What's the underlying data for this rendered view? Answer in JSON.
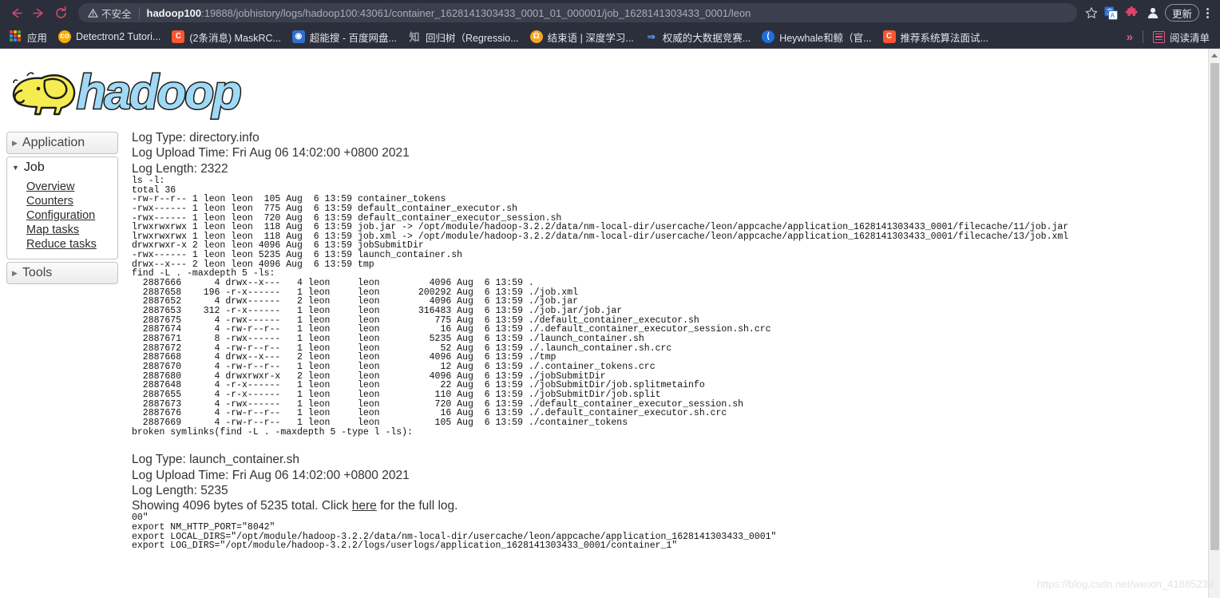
{
  "browser": {
    "nav": {
      "back": "back-arrow",
      "forward": "forward-arrow",
      "reload": "reload"
    },
    "security_label": "不安全",
    "url_host": "hadoop100",
    "url_rest": ":19888/jobhistory/logs/hadoop100:43061/container_1628141303433_0001_01_000001/job_1628141303433_0001/leon",
    "update_label": "更新",
    "bookmarks": [
      {
        "label": "应用",
        "icon": "apps-grid-icon",
        "color": "#4285f4"
      },
      {
        "label": "Detectron2 Tutori...",
        "icon": "colab-icon",
        "color": "#f9ab00"
      },
      {
        "label": "(2条消息) MaskRC...",
        "icon": "csdn-icon",
        "color": "#fc5531"
      },
      {
        "label": "超能搜 - 百度网盘...",
        "icon": "search-blue-icon",
        "color": "#2f6fd0"
      },
      {
        "label": "回归树（Regressio...",
        "icon": "zhihu-icon",
        "color": "#2b2f3b"
      },
      {
        "label": "结束语 | 深度学习...",
        "icon": "geekbang-icon",
        "color": "#f5a623"
      },
      {
        "label": "权威的大数据竞赛...",
        "icon": "ddc-icon",
        "color": "#3a7bd5"
      },
      {
        "label": "Heywhale和鲸（官...",
        "icon": "heywhale-icon",
        "color": "#1e6fd9"
      },
      {
        "label": "推荐系统算法面试...",
        "icon": "csdn-icon",
        "color": "#fc5531"
      }
    ],
    "overflow_label": "»",
    "reading_list_label": "阅读清单"
  },
  "brand": {
    "logo_text": "hadoop"
  },
  "sidebar": {
    "application": {
      "label": "Application",
      "expanded": false
    },
    "job": {
      "label": "Job",
      "expanded": true,
      "links": [
        {
          "label": "Overview"
        },
        {
          "label": "Counters"
        },
        {
          "label": "Configuration"
        },
        {
          "label": "Map tasks"
        },
        {
          "label": "Reduce tasks"
        }
      ]
    },
    "tools": {
      "label": "Tools",
      "expanded": false
    }
  },
  "logs": [
    {
      "type_line": "Log Type: directory.info",
      "upload_line": "Log Upload Time: Fri Aug 06 14:02:00 +0800 2021",
      "length_line": "Log Length: 2322",
      "body": "ls -l:\ntotal 36\n-rw-r--r-- 1 leon leon  105 Aug  6 13:59 container_tokens\n-rwx------ 1 leon leon  775 Aug  6 13:59 default_container_executor.sh\n-rwx------ 1 leon leon  720 Aug  6 13:59 default_container_executor_session.sh\nlrwxrwxrwx 1 leon leon  118 Aug  6 13:59 job.jar -> /opt/module/hadoop-3.2.2/data/nm-local-dir/usercache/leon/appcache/application_1628141303433_0001/filecache/11/job.jar\nlrwxrwxrwx 1 leon leon  118 Aug  6 13:59 job.xml -> /opt/module/hadoop-3.2.2/data/nm-local-dir/usercache/leon/appcache/application_1628141303433_0001/filecache/13/job.xml\ndrwxrwxr-x 2 leon leon 4096 Aug  6 13:59 jobSubmitDir\n-rwx------ 1 leon leon 5235 Aug  6 13:59 launch_container.sh\ndrwx--x--- 2 leon leon 4096 Aug  6 13:59 tmp\nfind -L . -maxdepth 5 -ls:\n  2887666      4 drwx--x---   4 leon     leon         4096 Aug  6 13:59 .\n  2887658    196 -r-x------   1 leon     leon       200292 Aug  6 13:59 ./job.xml\n  2887652      4 drwx------   2 leon     leon         4096 Aug  6 13:59 ./job.jar\n  2887653    312 -r-x------   1 leon     leon       316483 Aug  6 13:59 ./job.jar/job.jar\n  2887675      4 -rwx------   1 leon     leon          775 Aug  6 13:59 ./default_container_executor.sh\n  2887674      4 -rw-r--r--   1 leon     leon           16 Aug  6 13:59 ./.default_container_executor_session.sh.crc\n  2887671      8 -rwx------   1 leon     leon         5235 Aug  6 13:59 ./launch_container.sh\n  2887672      4 -rw-r--r--   1 leon     leon           52 Aug  6 13:59 ./.launch_container.sh.crc\n  2887668      4 drwx--x---   2 leon     leon         4096 Aug  6 13:59 ./tmp\n  2887670      4 -rw-r--r--   1 leon     leon           12 Aug  6 13:59 ./.container_tokens.crc\n  2887680      4 drwxrwxr-x   2 leon     leon         4096 Aug  6 13:59 ./jobSubmitDir\n  2887648      4 -r-x------   1 leon     leon           22 Aug  6 13:59 ./jobSubmitDir/job.splitmetainfo\n  2887655      4 -r-x------   1 leon     leon          110 Aug  6 13:59 ./jobSubmitDir/job.split\n  2887673      4 -rwx------   1 leon     leon          720 Aug  6 13:59 ./default_container_executor_session.sh\n  2887676      4 -rw-r--r--   1 leon     leon           16 Aug  6 13:59 ./.default_container_executor.sh.crc\n  2887669      4 -rw-r--r--   1 leon     leon          105 Aug  6 13:59 ./container_tokens\nbroken symlinks(find -L . -maxdepth 5 -type l -ls):"
    },
    {
      "type_line": "Log Type: launch_container.sh",
      "upload_line": "Log Upload Time: Fri Aug 06 14:02:00 +0800 2021",
      "length_line": "Log Length: 5235",
      "showing_prefix": "Showing 4096 bytes of 5235 total. Click ",
      "showing_link": "here",
      "showing_suffix": " for the full log.",
      "body": "00\"\nexport NM_HTTP_PORT=\"8042\"\nexport LOCAL_DIRS=\"/opt/module/hadoop-3.2.2/data/nm-local-dir/usercache/leon/appcache/application_1628141303433_0001\"\nexport LOG_DIRS=\"/opt/module/hadoop-3.2.2/logs/userlogs/application_1628141303433_0001/container_1\""
    }
  ],
  "watermark": "https://blog.csdn.net/weixin_41885239"
}
